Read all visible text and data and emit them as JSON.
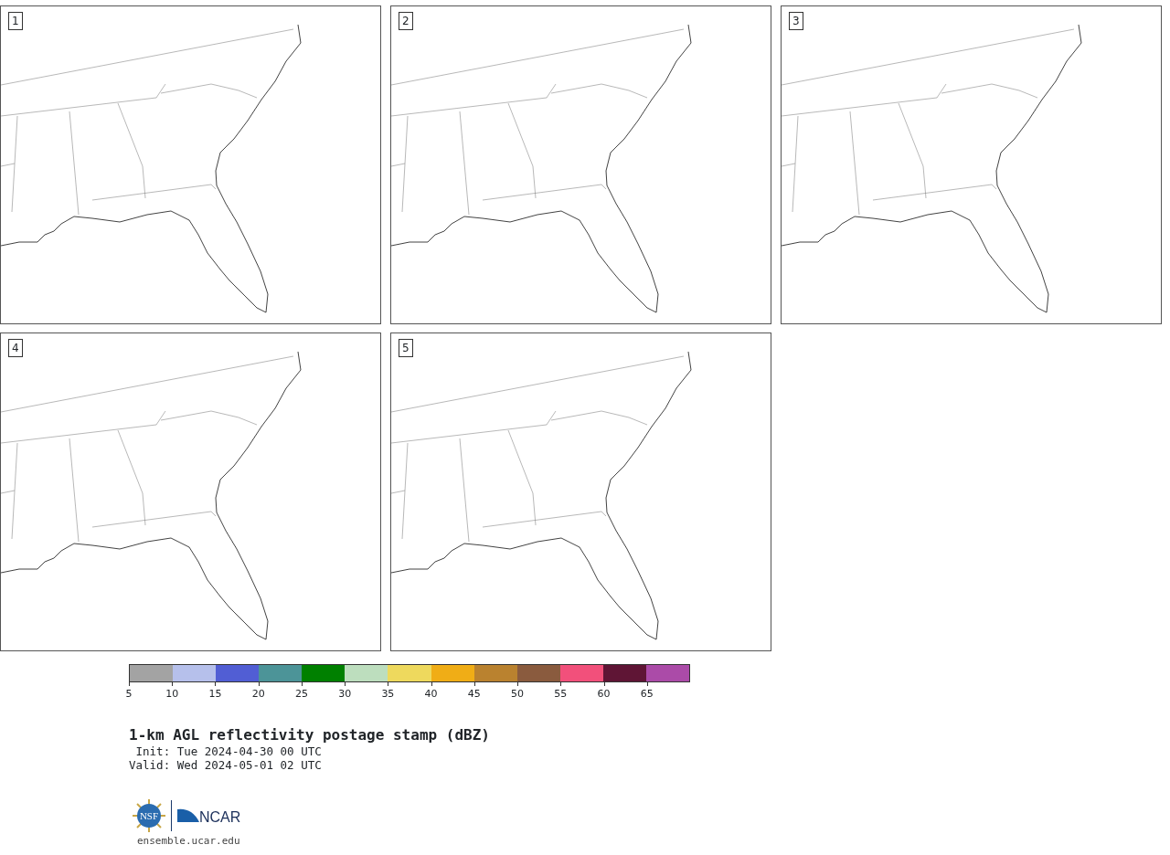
{
  "panels": [
    {
      "label": "1"
    },
    {
      "label": "2"
    },
    {
      "label": "3"
    },
    {
      "label": "4"
    },
    {
      "label": "5"
    }
  ],
  "colorbar": {
    "segments": [
      {
        "color": "#a3a3a3"
      },
      {
        "color": "#b6c0eb"
      },
      {
        "color": "#515ed4"
      },
      {
        "color": "#4c9498"
      },
      {
        "color": "#008000"
      },
      {
        "color": "#bddebe"
      },
      {
        "color": "#eed95d"
      },
      {
        "color": "#f0ad16"
      },
      {
        "color": "#ba822f"
      },
      {
        "color": "#8a5b3e"
      },
      {
        "color": "#f2507b"
      },
      {
        "color": "#5f1535"
      },
      {
        "color": "#ab4ba8"
      }
    ],
    "ticks": [
      "5",
      "10",
      "15",
      "20",
      "25",
      "30",
      "35",
      "40",
      "45",
      "50",
      "55",
      "60",
      "65"
    ]
  },
  "title": "1-km AGL reflectivity postage stamp (dBZ)",
  "init": " Init: Tue 2024-04-30 00 UTC",
  "valid": "Valid: Wed 2024-05-01 02 UTC",
  "logos": {
    "nsf": "NSF",
    "ncar": "NCAR"
  },
  "url": "ensemble.ucar.edu"
}
